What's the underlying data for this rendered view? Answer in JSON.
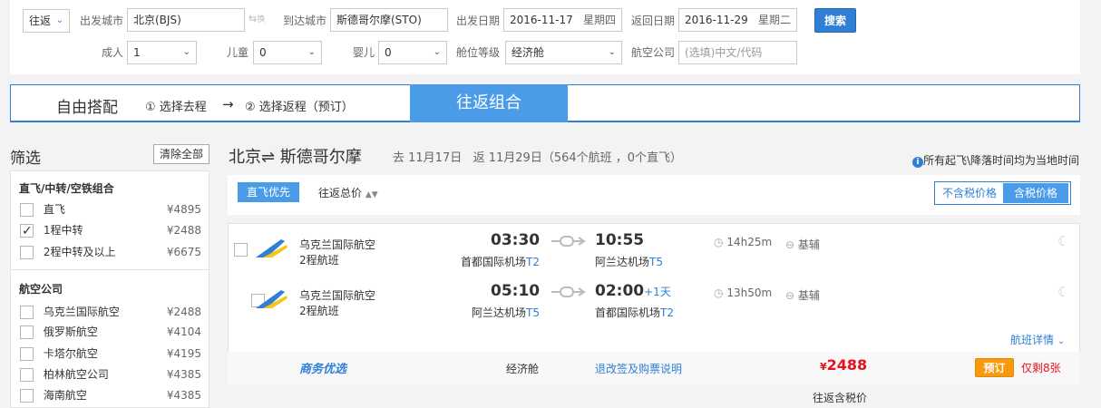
{
  "search": {
    "trip_type": "往返",
    "from_label": "出发城市",
    "from_value": "北京(BJS)",
    "swap_label": "换",
    "to_label": "到达城市",
    "to_value": "斯德哥尔摩(STO)",
    "depart_label": "出发日期",
    "depart_date": "2016-11-17",
    "depart_weekday": "星期四",
    "return_label": "返回日期",
    "return_date": "2016-11-29",
    "return_weekday": "星期二",
    "search_button": "搜索",
    "adult_label": "成人",
    "adult_value": "1",
    "child_label": "儿童",
    "child_value": "0",
    "infant_label": "婴儿",
    "infant_value": "0",
    "cabin_label": "舱位等级",
    "cabin_value": "经济舱",
    "airline_label": "航空公司",
    "airline_placeholder": "(选填)中文/代码"
  },
  "mode": {
    "free": "自由搭配",
    "step1": "① 选择去程",
    "arrow": "→",
    "step2": "② 选择返程（预订）",
    "combo": "往返组合"
  },
  "filter": {
    "title": "筛选",
    "clear": "清除全部",
    "sections": [
      {
        "title": "直飞/中转/空铁组合",
        "items": [
          {
            "label": "直飞",
            "price": "¥4895",
            "checked": false
          },
          {
            "label": "1程中转",
            "price": "¥2488",
            "checked": true
          },
          {
            "label": "2程中转及以上",
            "price": "¥6675",
            "checked": false
          }
        ]
      },
      {
        "title": "航空公司",
        "items": [
          {
            "label": "乌克兰国际航空",
            "price": "¥2488",
            "checked": false
          },
          {
            "label": "俄罗斯航空",
            "price": "¥4104",
            "checked": false
          },
          {
            "label": "卡塔尔航空",
            "price": "¥4195",
            "checked": false
          },
          {
            "label": "柏林航空公司",
            "price": "¥4385",
            "checked": false
          },
          {
            "label": "海南航空",
            "price": "¥4385",
            "checked": false
          }
        ]
      }
    ]
  },
  "results": {
    "route": "北京⇌ 斯德哥尔摩",
    "meta": "去 11月17日   返 11月29日（564个航班 ，0个直飞）",
    "tz_note": "所有起飞\\降落时间均为当地时间",
    "direct_first": "直飞优先",
    "total_price_sort": "往返总价",
    "tax_excl": "不含税价格",
    "tax_incl": "含税价格",
    "flights": [
      {
        "airline": "乌克兰国际航空",
        "type": "2程航班",
        "dep_time": "03:30",
        "dep_airport": "首都国际机场",
        "dep_term": "T2",
        "arr_time": "10:55",
        "arr_plus": "",
        "arr_airport": "阿兰达机场",
        "arr_term": "T5",
        "duration": "14h25m",
        "aircraft": "基辅"
      },
      {
        "airline": "乌克兰国际航空",
        "type": "2程航班",
        "dep_time": "05:10",
        "dep_airport": "阿兰达机场",
        "dep_term": "T5",
        "arr_time": "02:00",
        "arr_plus": "+1天",
        "arr_airport": "首都国际机场",
        "arr_term": "T2",
        "duration": "13h50m",
        "aircraft": "基辅"
      }
    ],
    "details_link": "航班详情",
    "fare": {
      "badge": "商务优选",
      "cabin": "经济舱",
      "rules": "退改签及购票说明",
      "currency": "¥",
      "price": "2488",
      "book": "预订",
      "remain": "仅剩8张",
      "total_label": "往返含税价"
    }
  },
  "colors": {
    "accent": "#2f7fd4",
    "accent_light": "#4b9ce8",
    "price_red": "#e5121e",
    "book_orange": "#f89a0c"
  }
}
